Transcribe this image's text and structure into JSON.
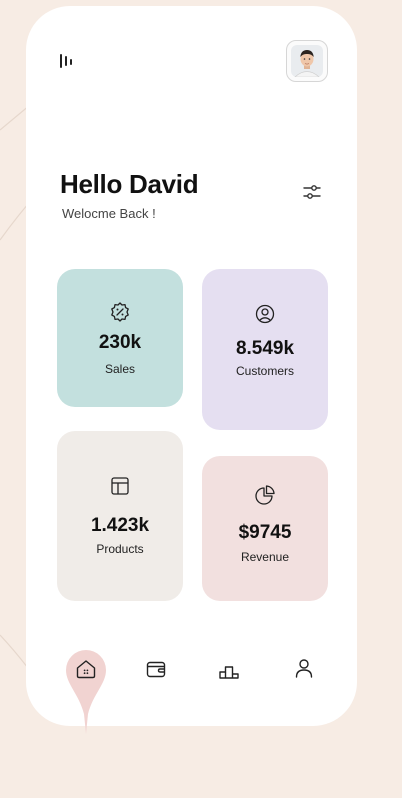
{
  "header": {
    "menu_icon": "menu-bars-icon",
    "avatar": "user-avatar-photo"
  },
  "greeting": {
    "title": "Hello David",
    "subtitle": "Welocme Back !",
    "filter_icon": "sliders-icon"
  },
  "cards": [
    {
      "value": "230k",
      "label": "Sales",
      "icon": "discount-badge-icon",
      "color": "#c3e0de"
    },
    {
      "value": "8.549k",
      "label": "Customers",
      "icon": "user-circle-icon",
      "color": "#e5dff1"
    },
    {
      "value": "1.423k",
      "label": "Products",
      "icon": "layout-icon",
      "color": "#f0ece8"
    },
    {
      "value": "$9745",
      "label": "Revenue",
      "icon": "pie-chart-icon",
      "color": "#f2e0df"
    }
  ],
  "bottom_nav": {
    "items": [
      "home-icon",
      "wallet-icon",
      "podium-icon",
      "user-icon"
    ],
    "active": "home",
    "indicator_color": "#f1d3d1"
  },
  "colors": {
    "background": "#f7ece4",
    "surface": "#ffffff",
    "text": "#111111"
  }
}
